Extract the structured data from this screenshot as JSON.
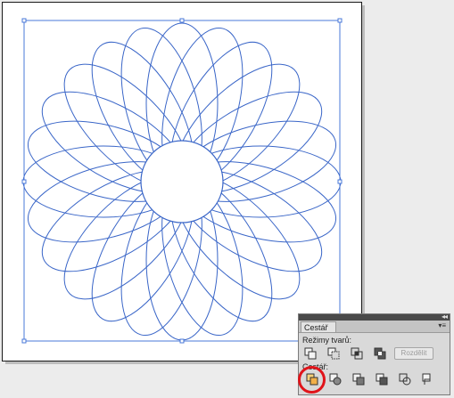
{
  "canvas": {
    "artwork": "spirograph-rosette",
    "stroke_color": "#3a66c8",
    "selection_color": "#4a78d8"
  },
  "panel": {
    "tab_label": "Cestář",
    "collapse_glyph": "◂◂",
    "menu_glyph": "▾≡",
    "shape_modes_label": "Režimy tvarů:",
    "pathfinders_label": "Cestář:",
    "split_button_label": "Rozdělit",
    "shape_modes": [
      "unite-icon",
      "minus-front-icon",
      "intersect-icon",
      "exclude-icon"
    ],
    "pathfinders": [
      "divide-icon",
      "trim-icon",
      "merge-icon",
      "crop-icon",
      "outline-icon",
      "minus-back-icon"
    ]
  },
  "annotation": {
    "highlight_color": "#e0141a"
  }
}
